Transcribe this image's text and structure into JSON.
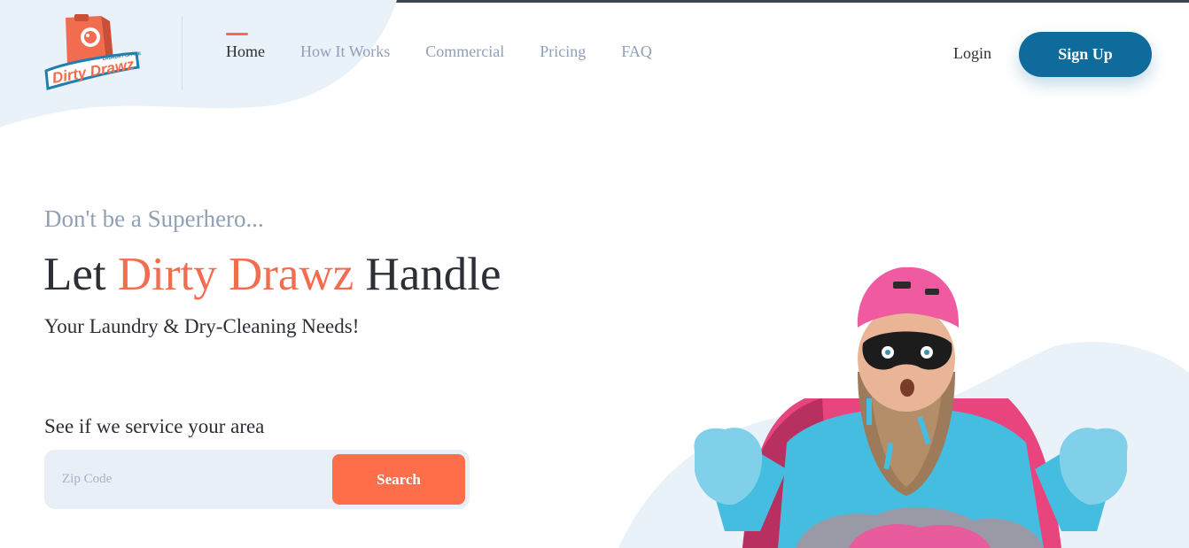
{
  "brand": {
    "logo_text": "Dirty Drawz",
    "logo_subtext": "LAUNDRY OFFICE",
    "accent_color": "#f26c4f",
    "primary_color": "#0f6b9c"
  },
  "nav": {
    "items": [
      {
        "label": "Home",
        "active": true
      },
      {
        "label": "How It Works",
        "active": false
      },
      {
        "label": "Commercial",
        "active": false
      },
      {
        "label": "Pricing",
        "active": false
      },
      {
        "label": "FAQ",
        "active": false
      }
    ],
    "login_label": "Login",
    "signup_label": "Sign Up"
  },
  "hero": {
    "tagline": "Don't be a Superhero...",
    "headline_prefix": "Let ",
    "headline_brand": "Dirty Drawz",
    "headline_suffix": " Handle",
    "subhead": "Your Laundry & Dry-Cleaning Needs!",
    "image_icon": "superhero-bearded-man-image"
  },
  "service_check": {
    "label": "See if we service your area",
    "zip_placeholder": "Zip Code",
    "zip_value": "",
    "search_label": "Search"
  }
}
